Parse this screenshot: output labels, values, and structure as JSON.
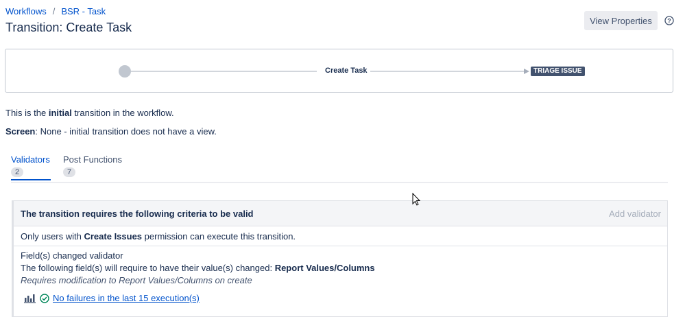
{
  "breadcrumb": {
    "items": [
      "Workflows",
      "BSR - Task"
    ],
    "separator": "/"
  },
  "page_title": "Transition: Create Task",
  "view_properties_label": "View Properties",
  "diagram": {
    "transition_label": "Create Task",
    "target_status": "TRIAGE ISSUE"
  },
  "info": {
    "initial_prefix": "This is the ",
    "initial_bold": "initial",
    "initial_suffix": " transition in the workflow.",
    "screen_label": "Screen",
    "screen_value": ": None - initial transition does not have a view."
  },
  "tabs": [
    {
      "label": "Validators",
      "count": "2"
    },
    {
      "label": "Post Functions",
      "count": "7"
    }
  ],
  "panel": {
    "heading": "The transition requires the following criteria to be valid",
    "add_validator": "Add validator",
    "permission_prefix": "Only users with ",
    "permission_bold": "Create Issues",
    "permission_suffix": " permission can execute this transition.",
    "validator_name": "Field(s) changed validator",
    "validator_desc_prefix": "The following field(s) will require to have their value(s) changed: ",
    "validator_desc_bold": "Report Values/Columns",
    "validator_note": "Requires modification to Report Values/Columns on create",
    "execution_status": "No failures in the last 15 execution(s)"
  },
  "colors": {
    "accent": "#0052cc",
    "lozenge": "#42526e",
    "success": "#00875a"
  },
  "icons": [
    "help-icon",
    "bar-chart-icon",
    "check-circle-icon",
    "cursor-icon"
  ]
}
